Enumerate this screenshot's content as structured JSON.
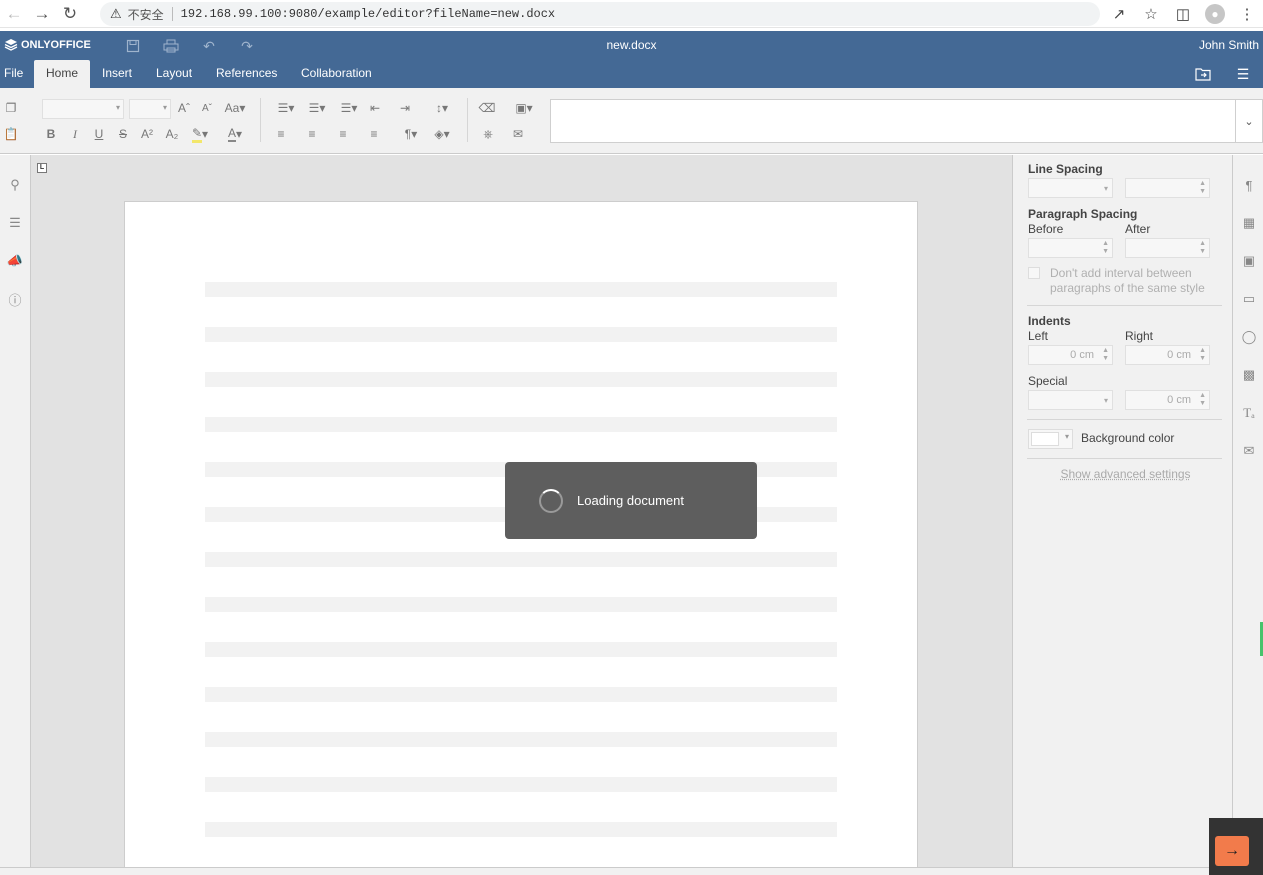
{
  "browser": {
    "insecure_label": "不安全",
    "url": "192.168.99.100:9080/example/editor?fileName=new.docx"
  },
  "app": {
    "logo_text": "ONLYOFFICE",
    "doc_title": "new.docx",
    "user_name": "John Smith"
  },
  "tabs": [
    {
      "label": "File"
    },
    {
      "label": "Home"
    },
    {
      "label": "Insert"
    },
    {
      "label": "Layout"
    },
    {
      "label": "References"
    },
    {
      "label": "Collaboration"
    }
  ],
  "toolbar": {
    "bold": "B",
    "italic": "I",
    "underline": "U",
    "strike": "S",
    "font_color": "A",
    "change_case": "Aa"
  },
  "loading": {
    "text": "Loading document"
  },
  "settings": {
    "line_spacing": "Line Spacing",
    "paragraph_spacing": "Paragraph Spacing",
    "before": "Before",
    "after": "After",
    "dont_add_interval_1": "Don't add interval between",
    "dont_add_interval_2": "paragraphs of the same style",
    "indents": "Indents",
    "left": "Left",
    "right": "Right",
    "left_value": "0 cm",
    "right_value": "0 cm",
    "special": "Special",
    "special_value": "0 cm",
    "background_color": "Background color",
    "show_advanced": "Show advanced settings"
  },
  "colors": {
    "header_bg": "#446995",
    "panel_bg": "#f1f1f1",
    "loading_bg": "#555555",
    "accent_orange": "#f27b4b"
  }
}
